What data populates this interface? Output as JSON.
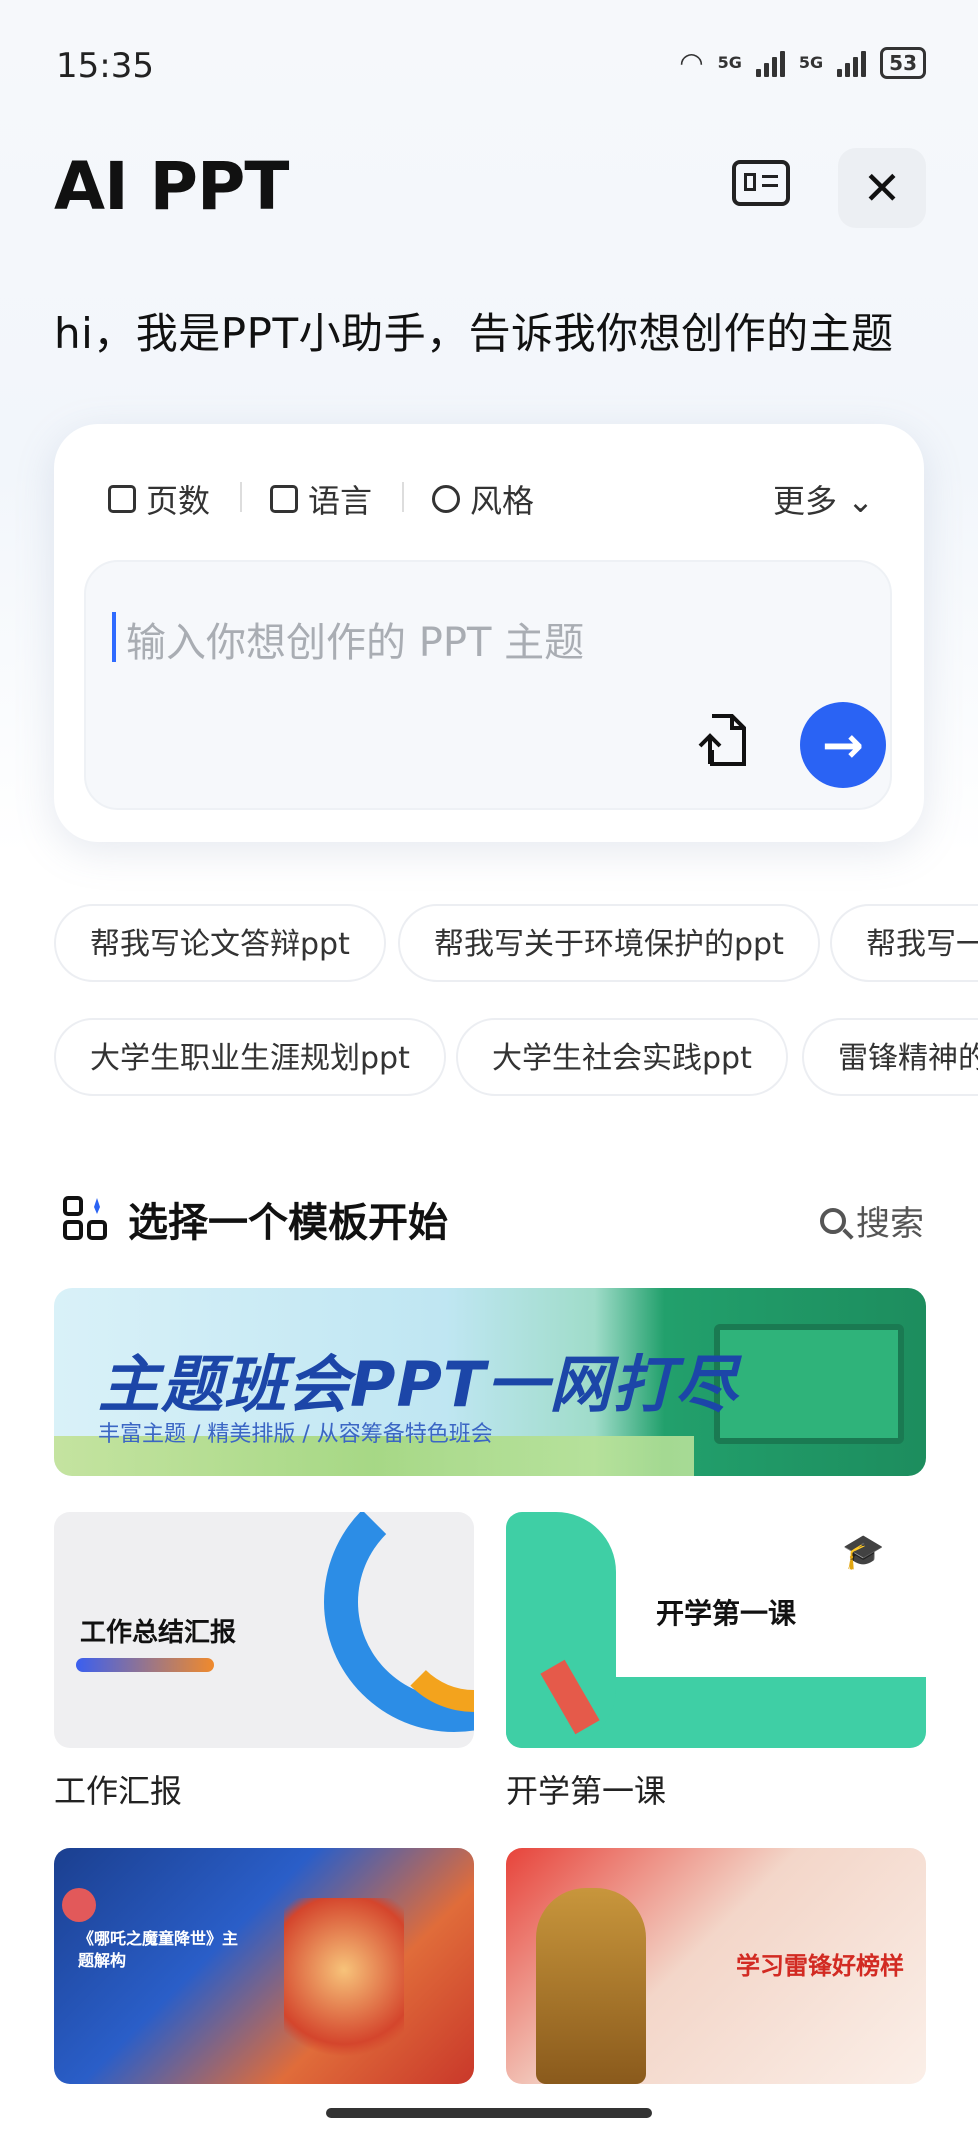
{
  "status_bar": {
    "time": "15:35",
    "network1": "5G",
    "network2": "5G",
    "battery": "53"
  },
  "header": {
    "title": "AI PPT",
    "close_glyph": "✕"
  },
  "greeting": "hi，我是PPT小助手，告诉我你想创作的主题",
  "options": {
    "pages": "页数",
    "language": "语言",
    "style": "风格",
    "more": "更多 ⌄"
  },
  "input": {
    "placeholder": "输入你想创作的 PPT 主题"
  },
  "chips_row1": [
    "帮我写论文答辩ppt",
    "帮我写关于环境保护的ppt",
    "帮我写一"
  ],
  "chips_row2": [
    "大学生职业生涯规划ppt",
    "大学生社会实践ppt",
    "雷锋精神的"
  ],
  "section": {
    "title": "选择一个模板开始",
    "search": "搜索"
  },
  "banner": {
    "title": "主题班会PPT一网打尽",
    "subtitle": "丰富主题 / 精美排版 / 从容筹备特色班会"
  },
  "templates": [
    {
      "label": "工作汇报",
      "thumb_text": "工作总结汇报"
    },
    {
      "label": "开学第一课",
      "thumb_text": "开学第一课"
    },
    {
      "thumb_text": "《哪吒之魔童降世》主题解构"
    },
    {
      "thumb_text": "学习雷锋好榜样"
    }
  ],
  "colors": {
    "accent": "#2a63f4",
    "banner_title": "#1c46a8"
  }
}
